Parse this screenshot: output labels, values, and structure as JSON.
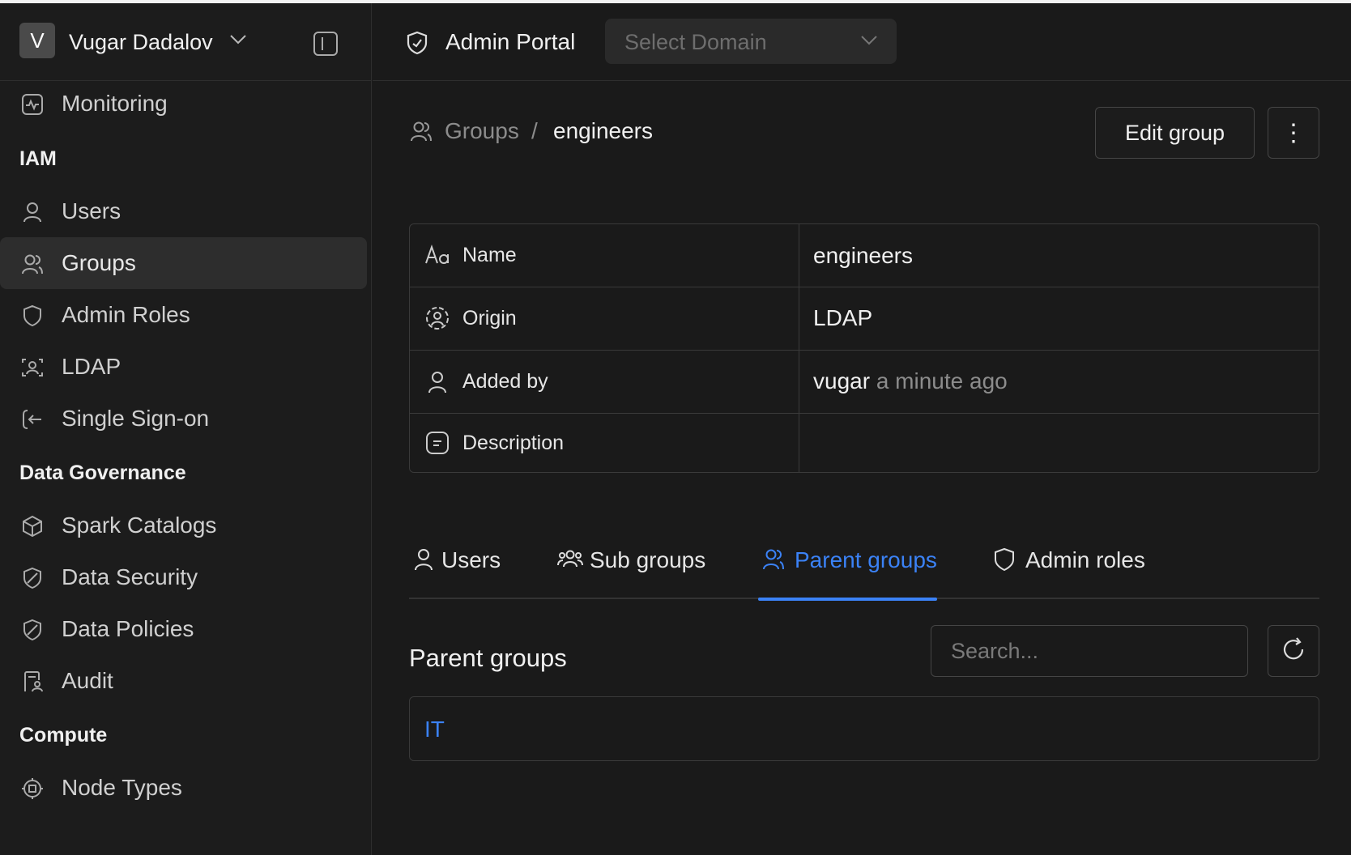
{
  "user": {
    "initial": "V",
    "name": "Vugar Dadalov"
  },
  "sidebar": {
    "monitoring": "Monitoring",
    "sections": {
      "iam": "IAM",
      "governance": "Data Governance",
      "compute": "Compute"
    },
    "iam_items": [
      "Users",
      "Groups",
      "Admin Roles",
      "LDAP",
      "Single Sign-on"
    ],
    "governance_items": [
      "Spark Catalogs",
      "Data Security",
      "Data Policies",
      "Audit"
    ],
    "compute_items": [
      "Node Types"
    ],
    "active": "Groups"
  },
  "topbar": {
    "title": "Admin Portal",
    "domain_placeholder": "Select Domain"
  },
  "breadcrumb": {
    "parent": "Groups",
    "separator": "/",
    "current": "engineers"
  },
  "actions": {
    "edit": "Edit group",
    "more": "⋮"
  },
  "properties": {
    "name_label": "Name",
    "name_value": "engineers",
    "origin_label": "Origin",
    "origin_value": "LDAP",
    "added_by_label": "Added by",
    "added_by_user": "vugar",
    "added_by_time": "a minute ago",
    "description_label": "Description",
    "description_value": ""
  },
  "tabs": [
    "Users",
    "Sub groups",
    "Parent groups",
    "Admin roles"
  ],
  "active_tab": "Parent groups",
  "parent_groups": {
    "heading": "Parent groups",
    "search_placeholder": "Search...",
    "items": [
      "IT"
    ]
  },
  "colors": {
    "accent": "#3b82f6",
    "background": "#1a1a1a"
  }
}
